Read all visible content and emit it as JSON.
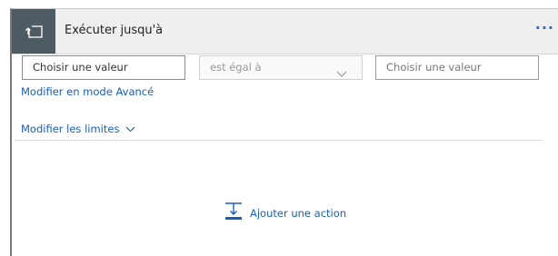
{
  "header": {
    "title": "Exécuter jusqu'à",
    "more_label": "···",
    "icon": "loop-until-icon"
  },
  "condition": {
    "left_value": "Choisir une valeur",
    "operator": "est égal à",
    "right_placeholder": "Choisir une valeur"
  },
  "links": {
    "advanced_mode": "Modifier en mode Avancé",
    "edit_limits": "Modifier les limites"
  },
  "add_action": {
    "label": "Ajouter une action",
    "icon": "add-action-icon"
  },
  "colors": {
    "accent": "#1a5fb4",
    "header_bg": "#efefef",
    "icon_bg": "#4f5b63"
  }
}
